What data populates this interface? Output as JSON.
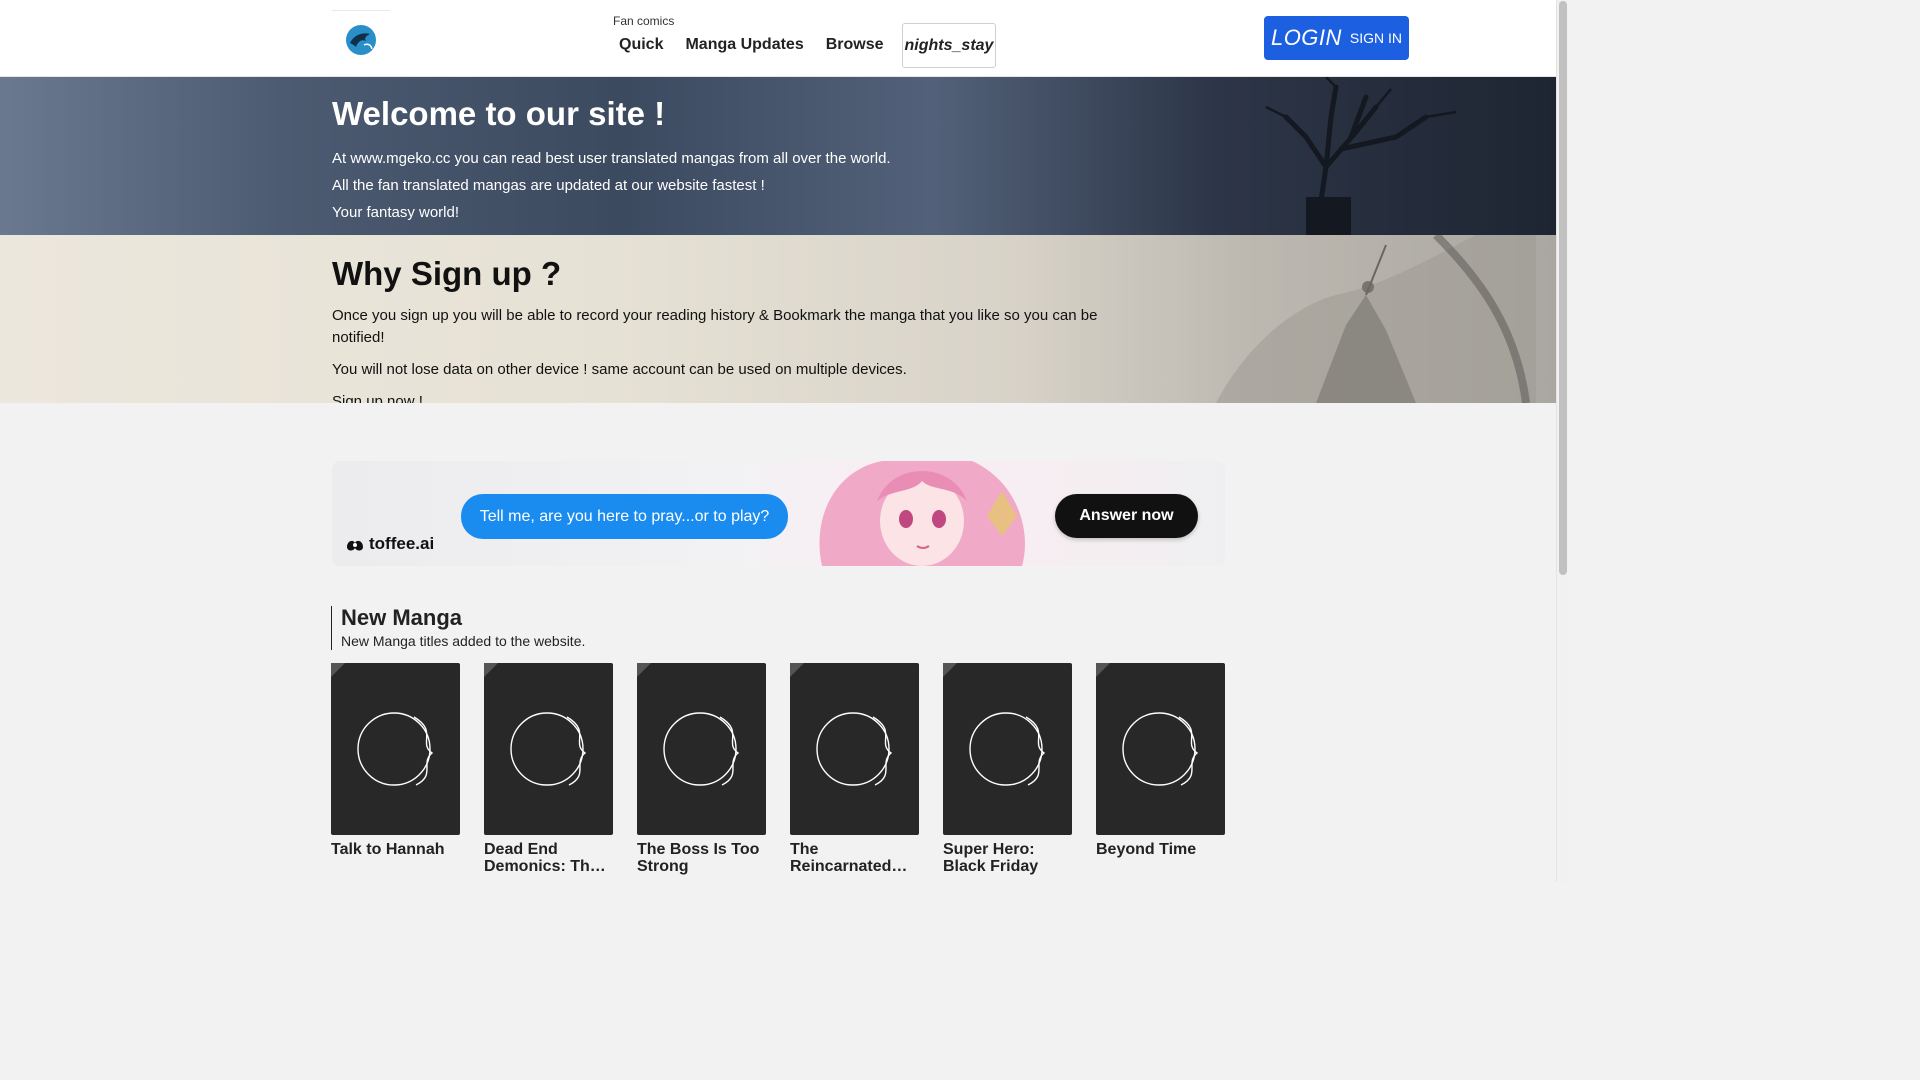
{
  "header": {
    "logo_icon": "dragon-logo-icon",
    "nav_caption": "Fan comics",
    "nav": [
      {
        "label": "Quick",
        "icon": "bolt-icon",
        "glyph": ""
      },
      {
        "label": "Manga Updates",
        "icon": "update-icon",
        "glyph": ""
      },
      {
        "label": "Browse",
        "icon": "browse-icon",
        "glyph": ""
      }
    ],
    "theme_toggle": "nights_stay",
    "login": {
      "big": "LOGIN",
      "small": "SIGN IN"
    }
  },
  "hero": {
    "title": "Welcome to our site !",
    "lines": [
      "At www.mgeko.cc you can read best user translated mangas from all over the world.",
      "All the fan translated mangas are updated at our website fastest !",
      "Your fantasy world!"
    ]
  },
  "why": {
    "title": "Why Sign up ?",
    "paragraphs": [
      "Once you sign up you will be able to record your reading history & Bookmark the manga that you like so you can be notified!",
      "You will not lose data on other device ! same account can be used on multiple devices.",
      "Sign up now !."
    ]
  },
  "ad": {
    "brand": "toffee.ai",
    "bubble": "Tell me, are you here to pray...or to play?",
    "cta": "Answer now"
  },
  "new_manga": {
    "title": "New Manga",
    "subtitle": "New Manga titles added to the website.",
    "items": [
      {
        "title": "Talk to Hannah"
      },
      {
        "title": "Dead End Demonics: The Cursed Blood Diaries"
      },
      {
        "title": "The Boss Is Too Strong"
      },
      {
        "title": "The Reincarnated Demon King Regret"
      },
      {
        "title": "Super Hero: Black Friday"
      },
      {
        "title": "Beyond Time"
      }
    ]
  },
  "colors": {
    "accent": "#1c5fe0",
    "ad_bubble": "#1a8cf0"
  }
}
